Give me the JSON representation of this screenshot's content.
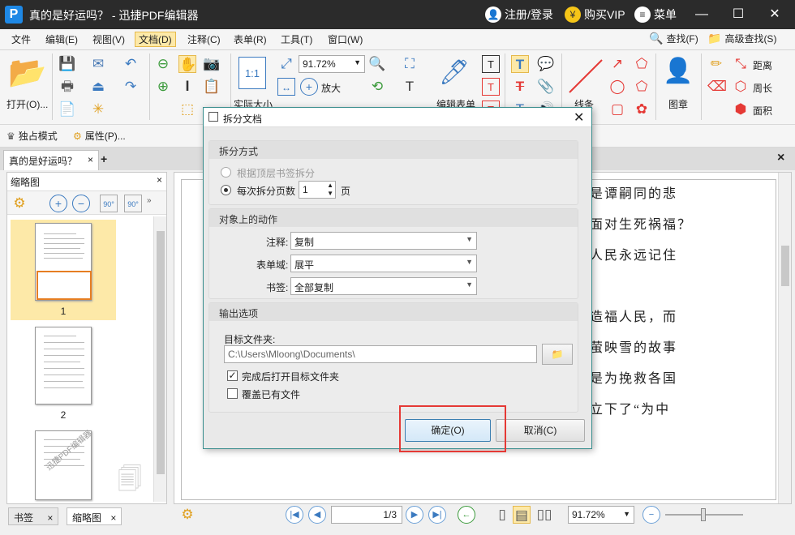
{
  "app": {
    "title": "真的是好运吗？ - 迅捷PDF编辑器",
    "logo": "P"
  },
  "titlebar": {
    "login": "注册/登录",
    "vip": "购买VIP",
    "menu": "菜单"
  },
  "menubar": [
    "文件",
    "编辑(E)",
    "视图(V)",
    "文档(D)",
    "注释(C)",
    "表单(R)",
    "工具(T)",
    "窗口(W)"
  ],
  "search": {
    "find": "查找(F)",
    "advanced": "高级查找(S)"
  },
  "ribbon": {
    "open": "打开(O)...",
    "zoom": "91.72%",
    "actual_size": "实际大小",
    "enlarge": "放大",
    "edit_form": "编辑表单",
    "line": "线条",
    "stamp": "图章",
    "distance": "距离",
    "perimeter": "周长",
    "area": "面积"
  },
  "row3": {
    "exclusive": "独占模式",
    "properties": "属性(P)..."
  },
  "tabs": {
    "doc": "真的是好运吗？",
    "add": "+",
    "close": "×"
  },
  "leftpanel": {
    "title": "缩略图",
    "rot_left": "90°",
    "rot_right": "90°",
    "pages": [
      "1",
      "2"
    ],
    "watermark": "迅捷PDF编辑器"
  },
  "doc": {
    "lines": [
      "是谭嗣同的悲",
      "面对生死祸福？",
      "人民永远记住",
      "造福人民，而",
      "萤映雪的故事",
      "是为挽救各国",
      "立下了“为中"
    ]
  },
  "statusbar": {
    "bookmark_tab": "书签",
    "thumb_tab": "缩略图",
    "page": "1/3",
    "zoom": "91.72%"
  },
  "dialog": {
    "title": "拆分文档",
    "split_group": "拆分方式",
    "opt_bookmark": "根据顶层书签拆分",
    "opt_pages": "每次拆分页数",
    "pages_value": "1",
    "pages_unit": "页",
    "action_group": "对象上的动作",
    "annot_label": "注释:",
    "annot_value": "复制",
    "form_label": "表单域:",
    "form_value": "展平",
    "bookmark_label": "书签:",
    "bookmark_value": "全部复制",
    "output_group": "输出选项",
    "folder_label": "目标文件夹:",
    "folder_value": "C:\\Users\\Mloong\\Documents\\",
    "open_after": "完成后打开目标文件夹",
    "overwrite": "覆盖已有文件",
    "ok": "确定(O)",
    "cancel": "取消(C)",
    "highlight_color": "#e53935"
  }
}
